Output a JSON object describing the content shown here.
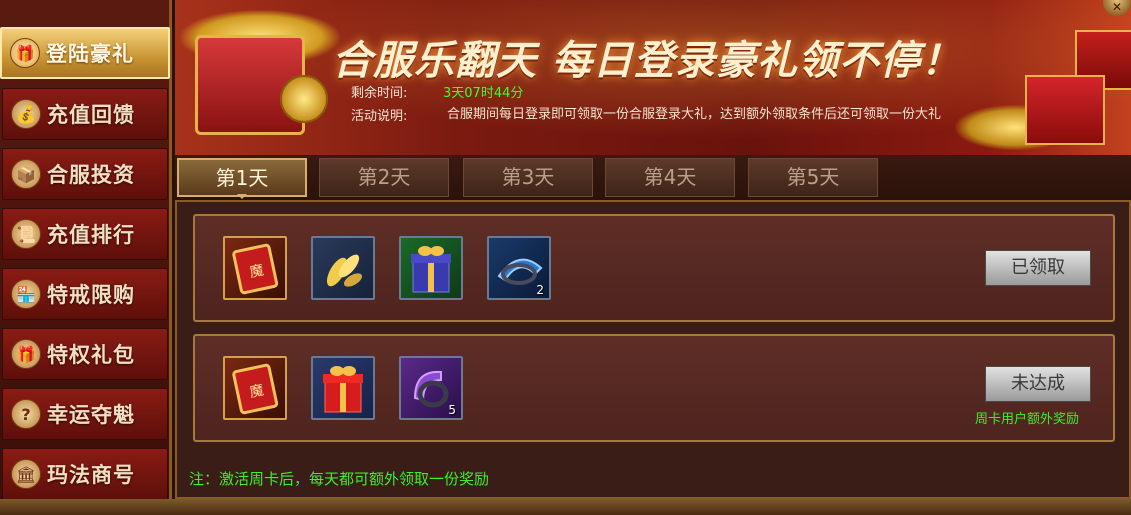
{
  "sidebar": {
    "items": [
      {
        "label": "登陆豪礼",
        "icon": "gift-icon",
        "glyph": "🎁",
        "active": true
      },
      {
        "label": "充值回馈",
        "icon": "money-bag-icon",
        "glyph": "💰",
        "active": false
      },
      {
        "label": "合服投资",
        "icon": "treasure-box-icon",
        "glyph": "📦",
        "active": false
      },
      {
        "label": "充值排行",
        "icon": "scroll-icon",
        "glyph": "📜",
        "active": false
      },
      {
        "label": "特戒限购",
        "icon": "shop-icon",
        "glyph": "🏪",
        "active": false
      },
      {
        "label": "特权礼包",
        "icon": "gift-icon",
        "glyph": "🎁",
        "active": false
      },
      {
        "label": "幸运夺魁",
        "icon": "question-icon",
        "glyph": "?",
        "active": false
      },
      {
        "label": "玛法商号",
        "icon": "store-icon",
        "glyph": "🏛",
        "active": false
      }
    ]
  },
  "banner": {
    "headline": "合服乐翻天 每日登录豪礼领不停！",
    "time_label": "剩余时间:",
    "time_value": "3天07时44分",
    "desc_label": "活动说明:",
    "desc_value": "合服期间每日登录即可领取一份合服登录大礼，达到额外领取条件后还可领取一份大礼"
  },
  "tabs": [
    {
      "label": "第1天",
      "active": true
    },
    {
      "label": "第2天",
      "active": false
    },
    {
      "label": "第3天",
      "active": false
    },
    {
      "label": "第4天",
      "active": false
    },
    {
      "label": "第5天",
      "active": false
    }
  ],
  "rows": [
    {
      "items": [
        {
          "icon": "red-token-icon",
          "count": ""
        },
        {
          "icon": "golden-leaves-icon",
          "count": ""
        },
        {
          "icon": "purple-giftbox-icon",
          "count": ""
        },
        {
          "icon": "blue-ring-icon",
          "count": "2"
        }
      ],
      "button_label": "已领取",
      "note": ""
    },
    {
      "items": [
        {
          "icon": "red-token-icon",
          "count": ""
        },
        {
          "icon": "red-giftbox-icon",
          "count": ""
        },
        {
          "icon": "purple-ring-icon",
          "count": "5"
        }
      ],
      "button_label": "未达成",
      "note": "周卡用户额外奖励"
    }
  ],
  "footer_note": "注：激活周卡后，每天都可额外领取一份奖励",
  "colors": {
    "accent_green": "#3cf02a",
    "gold_border": "#a67a38",
    "active_tab": "#d6b06a"
  }
}
